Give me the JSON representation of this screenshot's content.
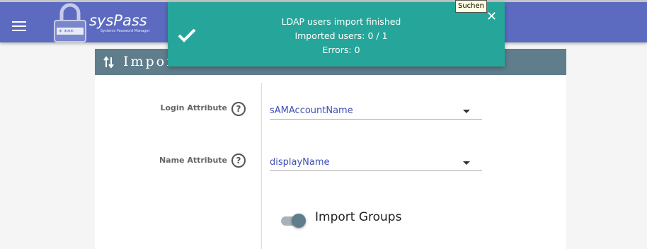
{
  "app": {
    "name": "sysPass",
    "subtitle": "Systems Password Manager"
  },
  "tooltip": {
    "text": "Suchen"
  },
  "notification": {
    "lines": [
      "LDAP users import finished",
      "Imported users: 0 / 1",
      "Errors: 0"
    ],
    "close": "✕",
    "icon": "checkmark-icon"
  },
  "card": {
    "title": "Impor",
    "icon": "import-arrows-icon"
  },
  "form": {
    "login_attribute": {
      "label": "Login Attribute",
      "value": "sAMAccountName",
      "help": "?"
    },
    "name_attribute": {
      "label": "Name Attribute",
      "value": "displayName",
      "help": "?"
    },
    "import_groups": {
      "label": "Import Groups",
      "enabled": true
    }
  },
  "colors": {
    "topbar": "#5c6bc0",
    "toast": "#26a69a",
    "card_header": "#607d8b",
    "select_text": "#3f51b5"
  }
}
